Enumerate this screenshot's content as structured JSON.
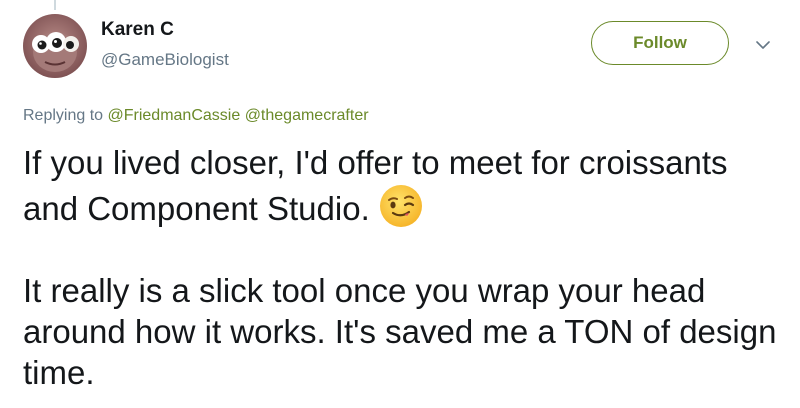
{
  "author": {
    "display_name": "Karen C",
    "handle": "@GameBiologist",
    "avatar_icon": "profile-avatar"
  },
  "follow_button": {
    "label": "Follow"
  },
  "menu": {
    "icon": "chevron-down-icon"
  },
  "reply": {
    "prefix": "Replying to",
    "mentions": [
      "@FriedmanCassie",
      "@thegamecrafter"
    ]
  },
  "tweet": {
    "paragraphs": [
      "If you lived closer, I'd offer to meet for croissants and Component Studio.",
      "It really is a slick tool once you wrap your head around how it works. It's saved me a TON of design time."
    ],
    "emoji": "winking-face-emoji"
  },
  "colors": {
    "accent": "#6b8a2a",
    "text": "#14171a",
    "secondary_text": "#657786"
  }
}
